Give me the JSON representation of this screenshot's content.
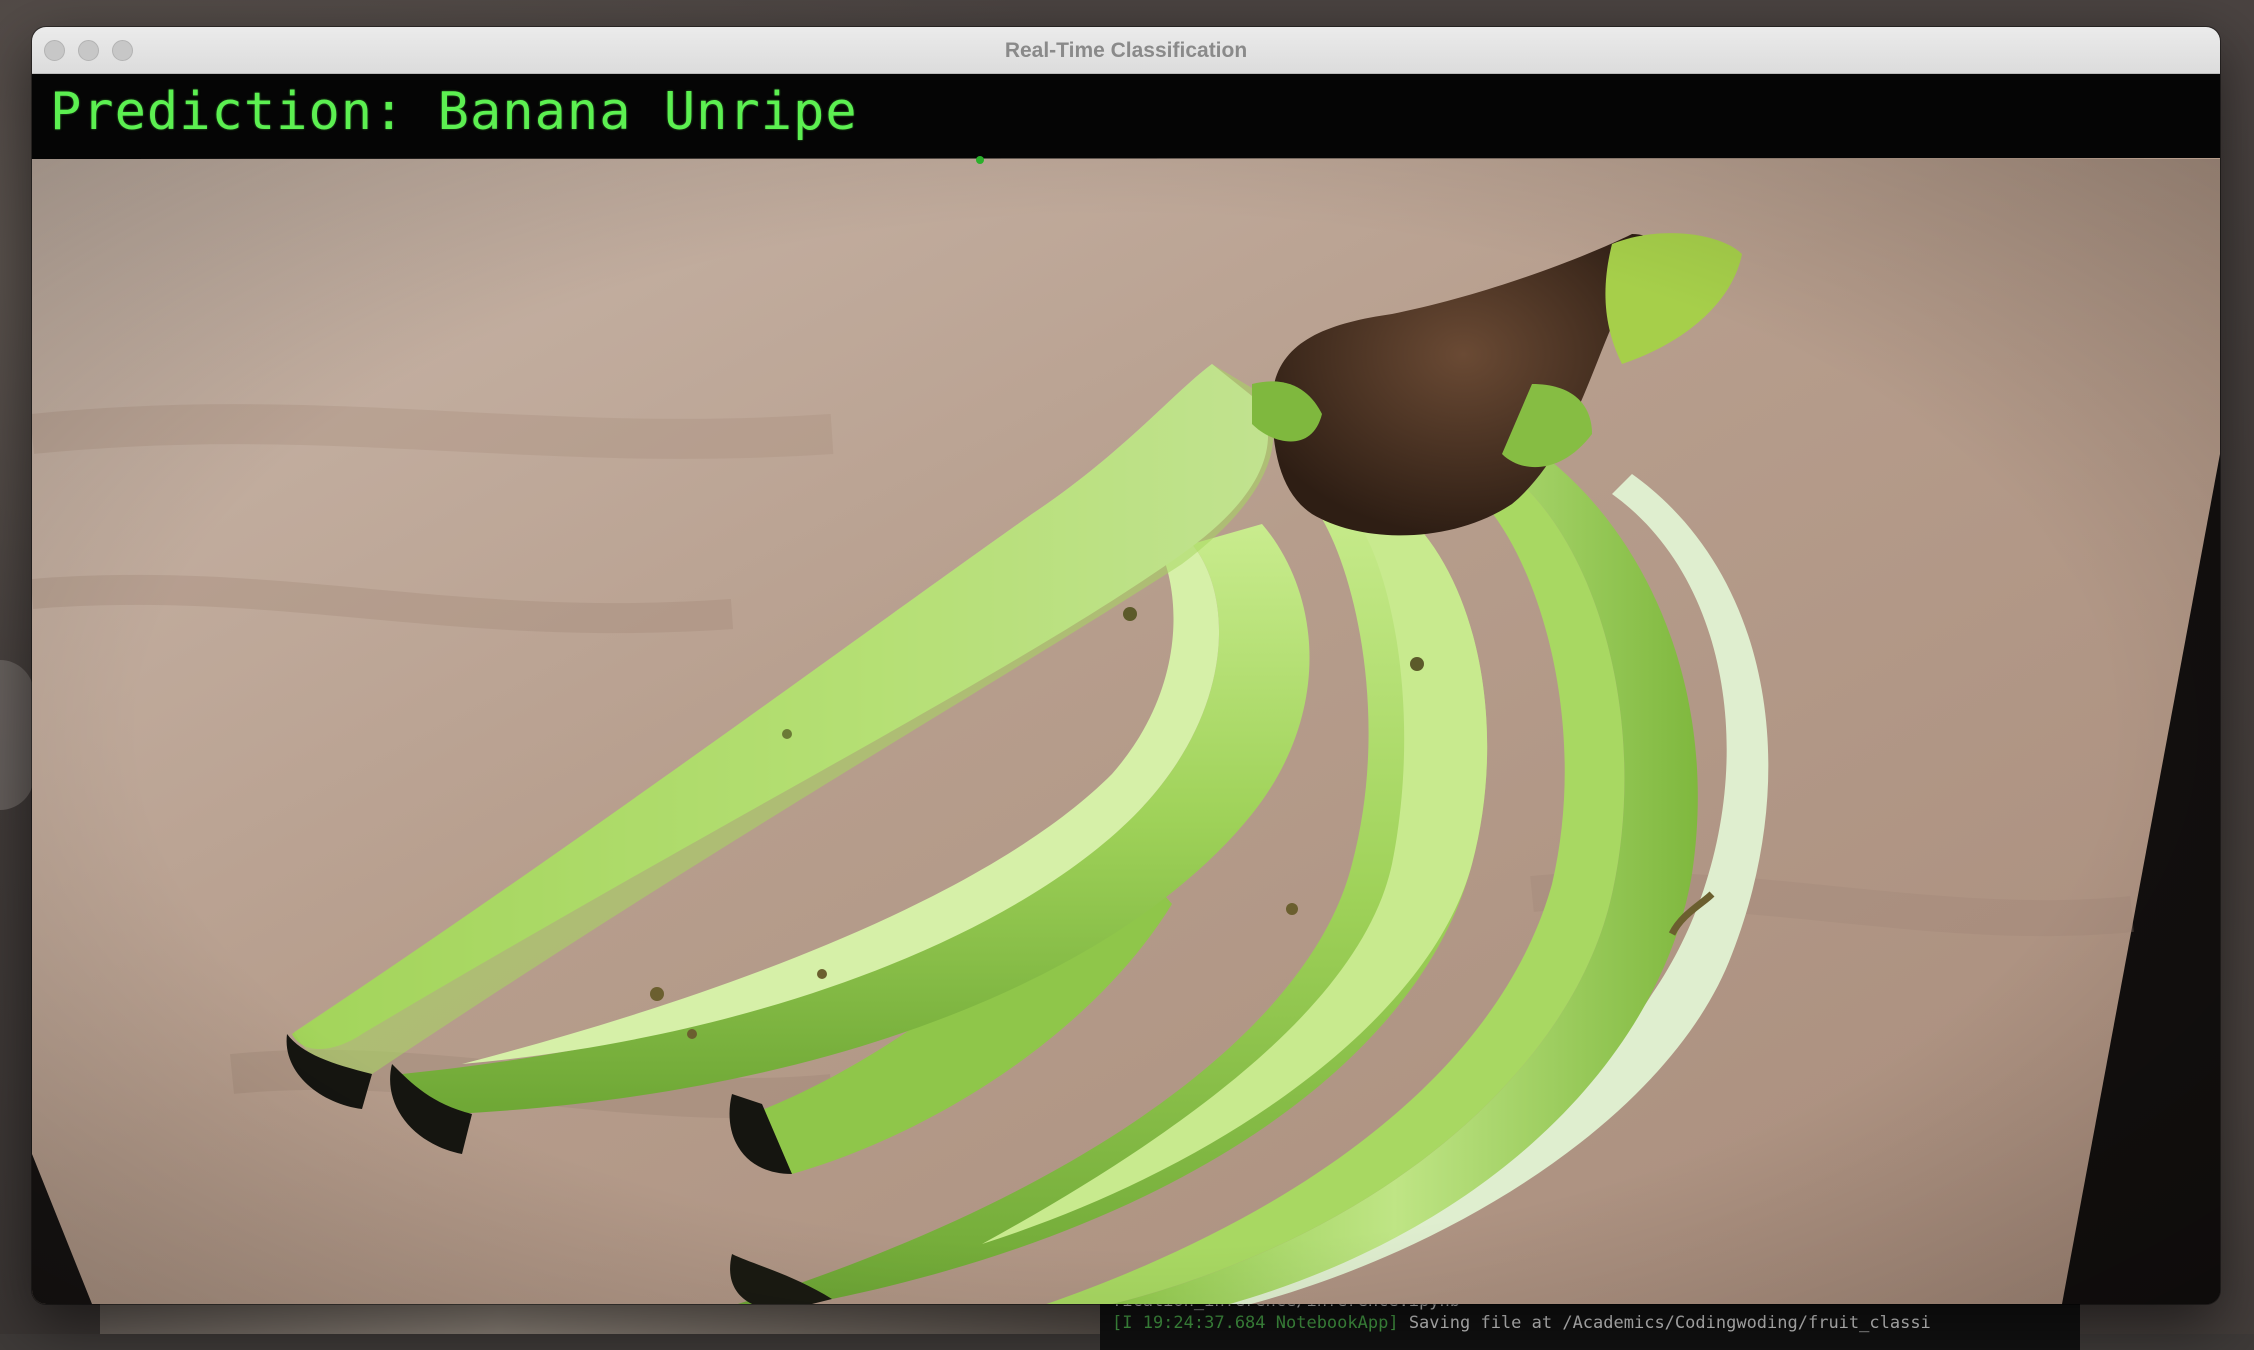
{
  "window": {
    "title": "Real-Time Classification"
  },
  "overlay": {
    "prediction_text": "Prediction: Banana Unripe",
    "text_color": "#5cf051"
  },
  "background_terminal": {
    "line1": "fication_inference/inference.ipynb",
    "line2_timestamp": "[I 19:24:37.684 NotebookApp]",
    "line2_message": " Saving file at /Academics/Codingwoding/fruit_classi"
  },
  "colors": {
    "titlebar": "#e4e4e4",
    "traffic_light": "#c7c7c7",
    "title_text": "#8a8a8a"
  }
}
